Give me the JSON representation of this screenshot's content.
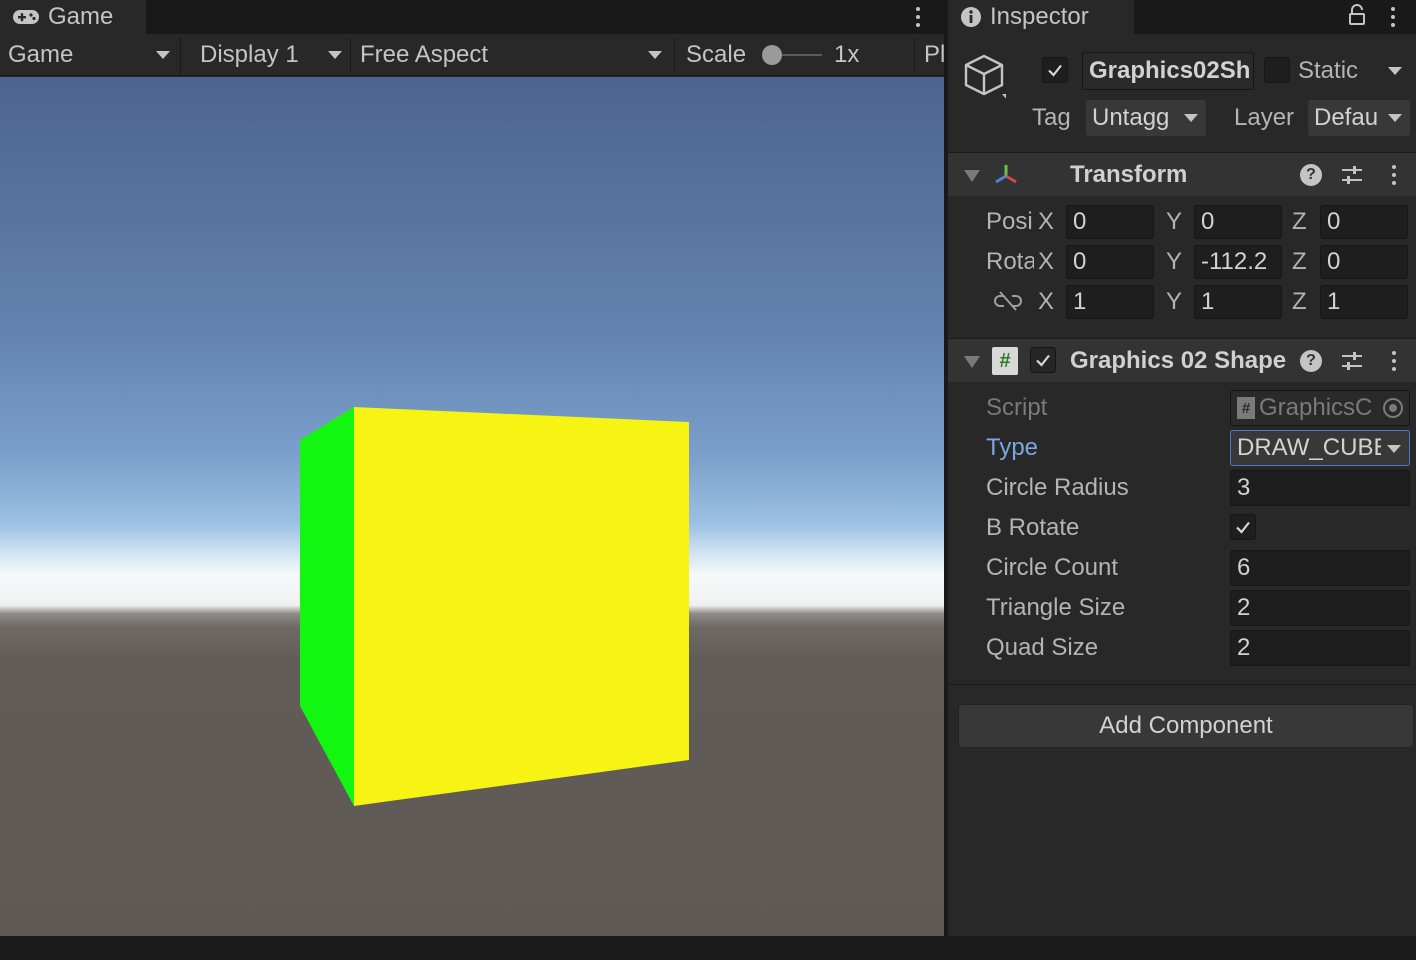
{
  "game": {
    "tab_label": "Game",
    "toolbar": {
      "view_mode": "Game",
      "display": "Display 1",
      "aspect": "Free Aspect",
      "scale_label": "Scale",
      "scale_value": "1x",
      "play_menu": "Pl"
    },
    "scene": {
      "cube_front_color": "#f7f313",
      "cube_side_color": "#13f612"
    }
  },
  "inspector": {
    "tab_label": "Inspector",
    "object": {
      "name": "Graphics02Sh",
      "static_label": "Static",
      "tag_label": "Tag",
      "tag_value": "Untagg",
      "layer_label": "Layer",
      "layer_value": "Defau"
    },
    "transform": {
      "title": "Transform",
      "position_label": "Posi",
      "rotation_label": "Rota",
      "position": {
        "x": "0",
        "y": "0",
        "z": "0"
      },
      "rotation": {
        "x": "0",
        "y": "-112.2",
        "z": "0"
      },
      "scale": {
        "x": "1",
        "y": "1",
        "z": "1"
      },
      "axis_x": "X",
      "axis_y": "Y",
      "axis_z": "Z"
    },
    "component": {
      "title": "Graphics 02 Shape",
      "script_label": "Script",
      "script_value": "GraphicsC",
      "type_label": "Type",
      "type_value": "DRAW_CUBE",
      "circle_radius_label": "Circle Radius",
      "circle_radius_value": "3",
      "b_rotate_label": "B Rotate",
      "circle_count_label": "Circle Count",
      "circle_count_value": "6",
      "triangle_size_label": "Triangle Size",
      "triangle_size_value": "2",
      "quad_size_label": "Quad Size",
      "quad_size_value": "2"
    },
    "add_component_label": "Add Component"
  },
  "icons": [
    "gamepad-icon",
    "info-icon",
    "lock-icon",
    "kebab-menu-icon",
    "cube-icon",
    "transform-axes-icon",
    "script-hash-icon",
    "help-icon",
    "presets-sliders-icon",
    "checkmark-icon",
    "unlink-scale-icon",
    "object-picker-icon"
  ],
  "colors": {
    "panel_bg": "#282828",
    "field_bg": "#1e1e1e",
    "type_label_blue": "#7ba6e0",
    "type_field_border": "#4b78c8"
  }
}
